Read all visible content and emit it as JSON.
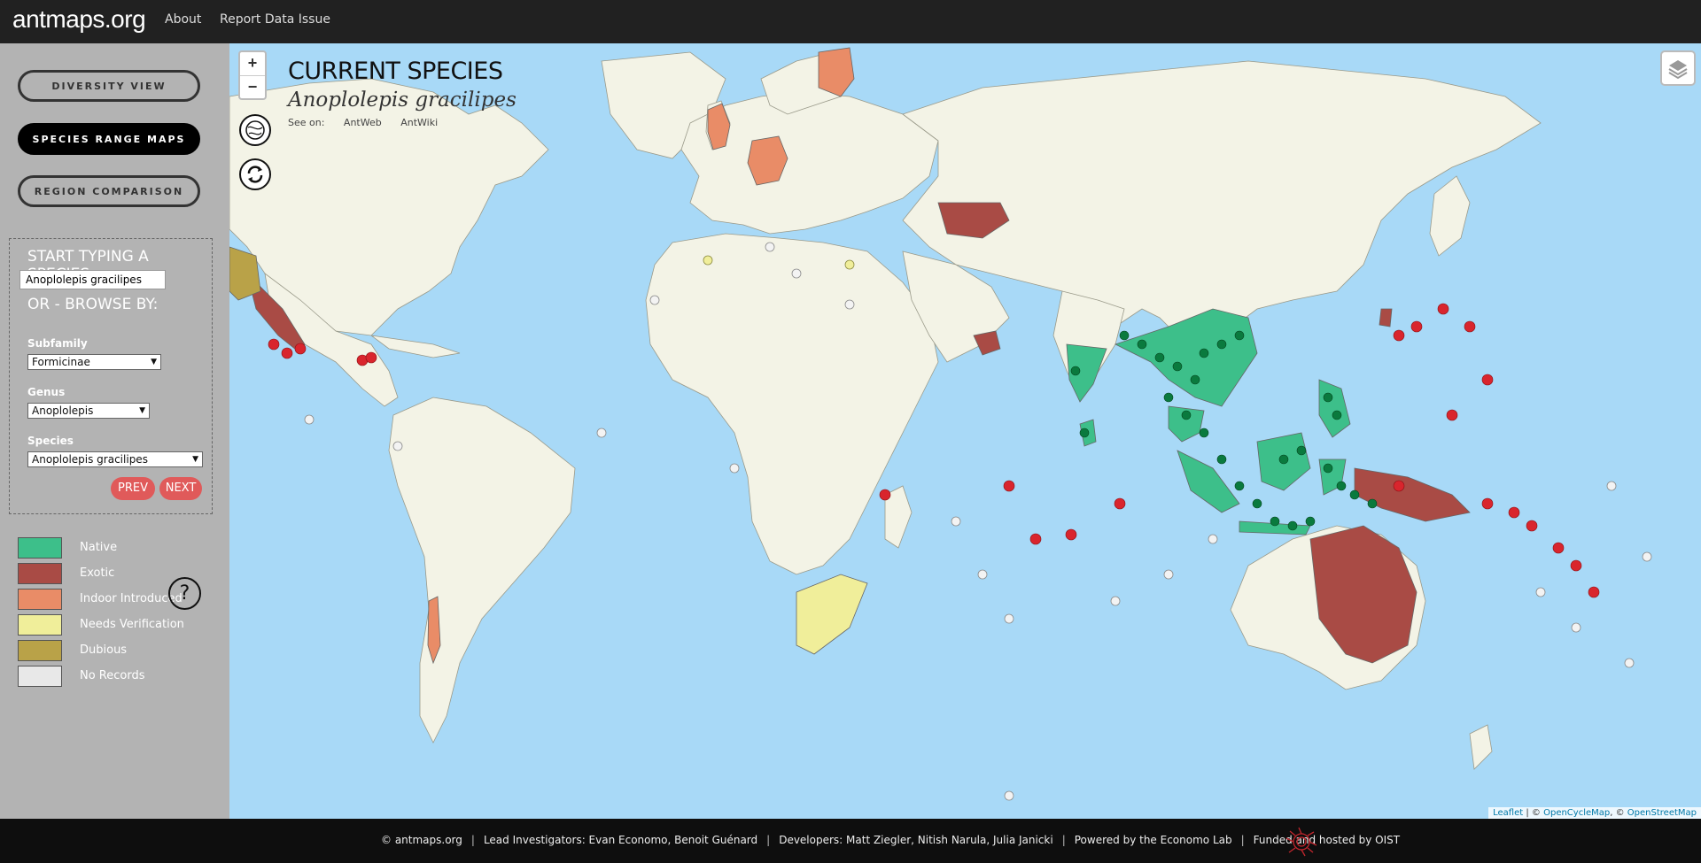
{
  "header": {
    "brand": "antmaps.org",
    "nav": [
      "About",
      "Report Data Issue"
    ]
  },
  "sidebar": {
    "views": [
      {
        "label": "DIVERSITY VIEW",
        "active": false
      },
      {
        "label": "SPECIES RANGE MAPS",
        "active": true
      },
      {
        "label": "REGION COMPARISON",
        "active": false
      }
    ],
    "search_heading": "START TYPING A SPECIES",
    "search_value": "Anoplolepis gracilipes",
    "browse_heading": "OR - BROWSE BY:",
    "filters": [
      {
        "label": "Subfamily",
        "value": "Formicinae"
      },
      {
        "label": "Genus",
        "value": "Anoplolepis"
      },
      {
        "label": "Species",
        "value": "Anoplolepis gracilipes"
      }
    ],
    "prev_label": "PREV",
    "next_label": "NEXT",
    "legend": [
      {
        "label": "Native",
        "color": "#3dbf8a"
      },
      {
        "label": "Exotic",
        "color": "#a94b45"
      },
      {
        "label": "Indoor Introduced",
        "color": "#e98c67"
      },
      {
        "label": "Needs Verification",
        "color": "#f0ee9a"
      },
      {
        "label": "Dubious",
        "color": "#b9a248"
      },
      {
        "label": "No Records",
        "color": "#e8e8e8"
      }
    ],
    "help_icon": "?"
  },
  "map": {
    "zoom_in": "+",
    "zoom_out": "−",
    "current_label": "CURRENT SPECIES",
    "current_species": "Anoplolepis gracilipes",
    "see_on_label": "See on:",
    "see_on_links": [
      "AntWeb",
      "AntWiki"
    ],
    "attribution": {
      "leaflet": "Leaflet",
      "sep": " | © ",
      "ocm": "OpenCycleMap",
      "sep2": ", © ",
      "osm": "OpenStreetMap"
    },
    "colors": {
      "ocean": "#a8d9f7",
      "land": "#f3f3e6",
      "native": "#3dbf8a",
      "native_dot": "#0a7a3e",
      "exotic": "#a94b45",
      "exotic_dot": "#d9252d",
      "indoor": "#e98c67",
      "verify": "#f0ee9a",
      "dubious": "#b9a248"
    }
  },
  "footer": {
    "items": [
      "© antmaps.org",
      "Lead Investigators: Evan Economo, Benoit Guénard",
      "Developers: Matt Ziegler, Nitish Narula, Julia Janicki",
      "Powered by the Economo Lab",
      "Funded and hosted by OIST"
    ]
  }
}
